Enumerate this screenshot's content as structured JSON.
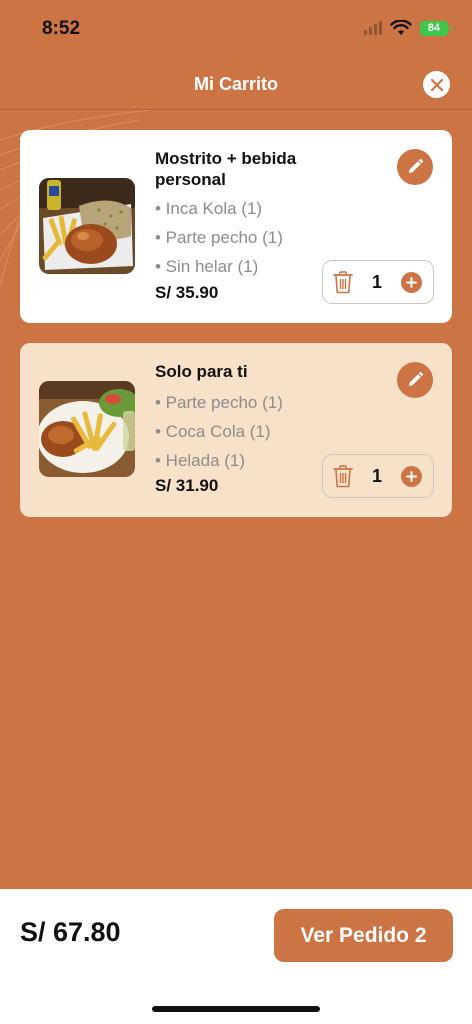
{
  "status": {
    "time": "8:52",
    "battery": "84"
  },
  "header": {
    "title": "Mi Carrito",
    "close_icon": "close-icon"
  },
  "items": [
    {
      "name": "Mostrito + bebida personal",
      "options": [
        "• Inca Kola (1)",
        "• Parte pecho (1)",
        "• Sin helar (1)"
      ],
      "price": "S/ 35.90",
      "quantity": "1",
      "background": "#ffffff",
      "image": "chicken-fries-rice-image"
    },
    {
      "name": "Solo para ti",
      "options": [
        "• Parte pecho (1)",
        "• Coca Cola (1)",
        "• Helada (1)"
      ],
      "price": "S/ 31.90",
      "quantity": "1",
      "background": "#F7E1C9",
      "image": "chicken-fries-salad-image"
    }
  ],
  "footer": {
    "total": "S/ 67.80",
    "order_button": "Ver Pedido 2"
  },
  "colors": {
    "accent": "#CC7444",
    "text": "#111111",
    "muted": "#8c8c8c"
  }
}
